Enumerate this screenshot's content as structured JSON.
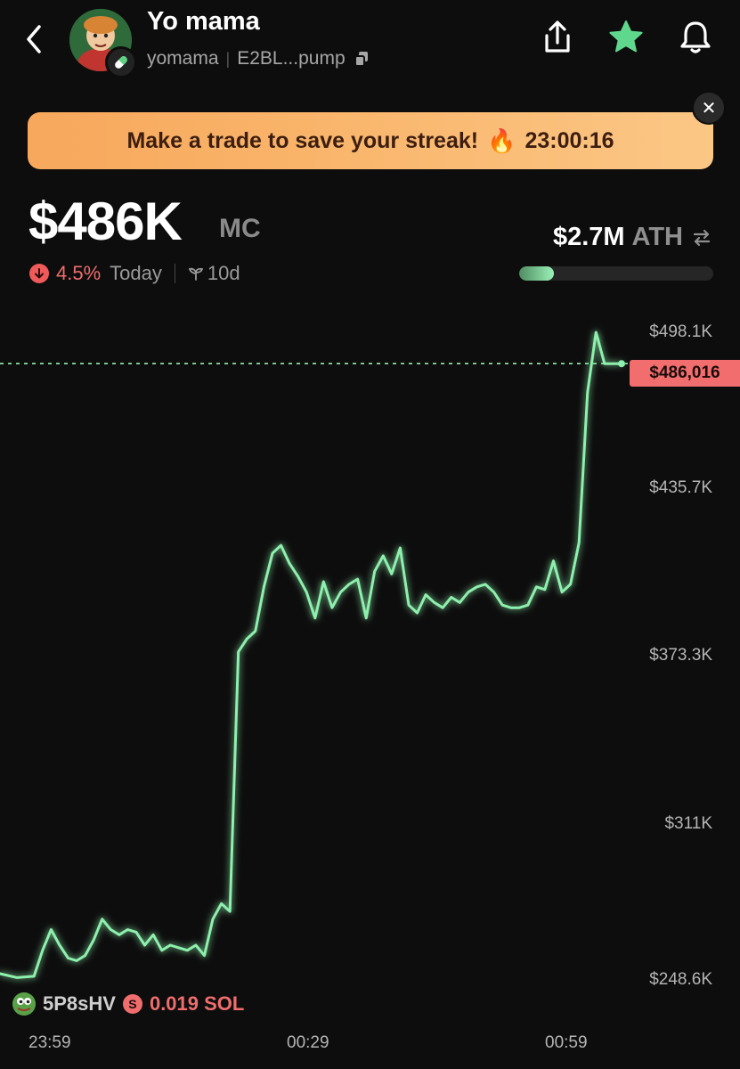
{
  "header": {
    "token_name": "Yo mama",
    "ticker": "yomama",
    "address": "E2BL...pump"
  },
  "banner": {
    "text": "Make a trade to save your streak!",
    "emoji": "🔥",
    "countdown": "23:00:16",
    "close_glyph": "✕"
  },
  "market": {
    "mc_value": "$486K",
    "mc_unit": "MC",
    "change_pct": "4.5%",
    "change_period": "Today",
    "age": "10d",
    "ath_value": "$2.7M",
    "ath_label": "ATH",
    "ath_progress": 0.18
  },
  "chart": {
    "current_price_label": "$486,016",
    "trade": {
      "trader": "5P8sHV",
      "amount": "0.019 SOL"
    }
  },
  "chart_data": {
    "type": "line",
    "y_ticks": [
      "$498.1K",
      "$435.7K",
      "$373.3K",
      "$311K",
      "$248.6K"
    ],
    "x_ticks": [
      "23:59",
      "00:29",
      "00:59"
    ],
    "ylim": [
      248600,
      498100
    ],
    "current_value": 486016,
    "line_color": "#8ef0ad",
    "x": [
      0,
      2,
      4,
      5,
      6,
      7,
      8,
      9,
      10,
      11,
      12,
      13,
      14,
      15,
      16,
      17,
      18,
      19,
      20,
      21,
      22,
      23,
      24,
      25,
      26,
      27,
      28,
      29,
      30,
      31,
      32,
      33,
      34,
      35,
      36,
      37,
      38,
      39,
      40,
      41,
      42,
      43,
      44,
      45,
      46,
      47,
      48,
      49,
      50,
      51,
      52,
      53,
      54,
      55,
      56,
      57,
      58,
      59,
      60,
      61,
      62,
      63,
      64,
      65,
      66,
      67,
      68,
      69,
      70,
      71,
      72,
      73
    ],
    "values": [
      251000,
      249500,
      250000,
      260000,
      268000,
      262000,
      257000,
      256000,
      258000,
      264000,
      272000,
      268000,
      266000,
      268000,
      267000,
      262000,
      266000,
      260000,
      262000,
      261000,
      260000,
      262000,
      258000,
      272000,
      278000,
      275000,
      375000,
      380000,
      383000,
      400000,
      413000,
      416000,
      409000,
      404000,
      398000,
      388000,
      402000,
      392000,
      398000,
      401000,
      403000,
      388000,
      406000,
      412000,
      405000,
      415000,
      393000,
      390000,
      397000,
      394000,
      392000,
      396000,
      394000,
      398000,
      400000,
      401000,
      398000,
      393000,
      392000,
      392000,
      393000,
      400000,
      399000,
      410000,
      398000,
      401000,
      417000,
      475000,
      498100,
      486016,
      486016,
      486016
    ],
    "note_x_range": "index"
  },
  "colors": {
    "accent_green": "#8ef0ad",
    "down_red": "#ef6d6d",
    "banner_orange": "#f9b46a"
  },
  "icons": [
    "back-chevron-icon",
    "share-icon",
    "star-icon",
    "bell-icon",
    "copy-icon",
    "close-icon",
    "down-arrow-icon",
    "sprout-icon",
    "solana-icon"
  ]
}
